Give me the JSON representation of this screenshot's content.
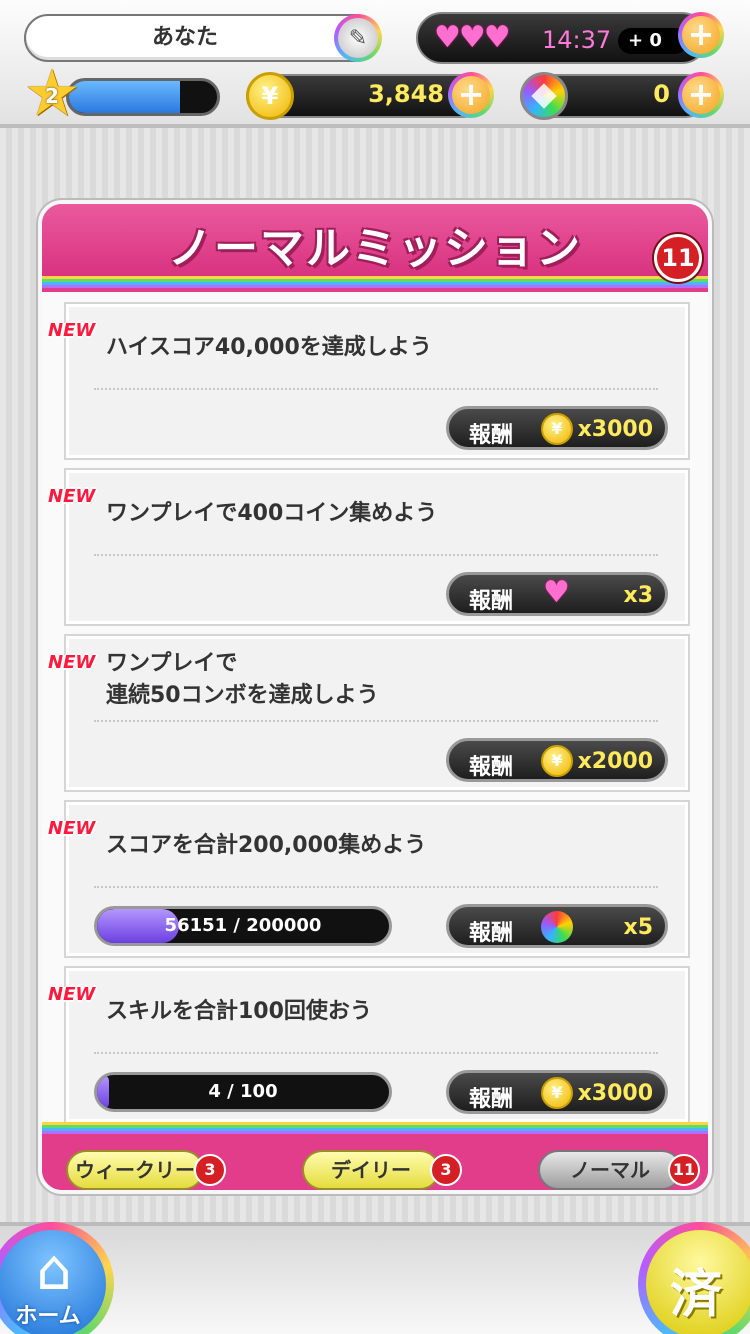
{
  "header": {
    "player_name": "あなた",
    "edit_icon": "pencil-icon",
    "lives": {
      "icon": "heart-icon",
      "count": 3,
      "timer": "14:37",
      "bonus": "+ 0"
    },
    "level": "2",
    "xp_progress": 0.75,
    "coins": "3,848",
    "coin_icon_glyph": "¥",
    "gems": "0",
    "plus_glyph": "+"
  },
  "panel": {
    "title": "ノーマルミッション",
    "count": "11",
    "new_label": "NEW",
    "reward_label": "報酬",
    "missions": [
      {
        "text": "ハイスコア40,000を達成しよう",
        "reward_icon": "coin-icon",
        "reward_qty": "x3000"
      },
      {
        "text": "ワンプレイで400コイン集めよう",
        "reward_icon": "heart-icon",
        "reward_qty": "x3"
      },
      {
        "text": "ワンプレイで\n連続50コンボを達成しよう",
        "reward_icon": "coin-icon",
        "reward_qty": "x2000"
      },
      {
        "text": "スコアを合計200,000集めよう",
        "reward_icon": "gem-icon",
        "reward_qty": "x5",
        "progress": {
          "text": "56151 / 200000",
          "value": 0.28
        }
      },
      {
        "text": "スキルを合計100回使おう",
        "reward_icon": "coin-icon",
        "reward_qty": "x3000",
        "progress": {
          "text": "4 / 100",
          "value": 0.04
        }
      }
    ]
  },
  "tabs": [
    {
      "label": "ウィークリー",
      "badge": "3"
    },
    {
      "label": "デイリー",
      "badge": "3"
    },
    {
      "label": "ノーマル",
      "badge": "11"
    }
  ],
  "bottom": {
    "home_label": "ホーム",
    "home_icon": "home-icon",
    "done_label": "済"
  },
  "colors": {
    "panel_pink": "#e23d8a",
    "reward_yellow": "#ffe95c",
    "badge_red": "#d41f24",
    "progress_purple": "#6c3fe0"
  }
}
